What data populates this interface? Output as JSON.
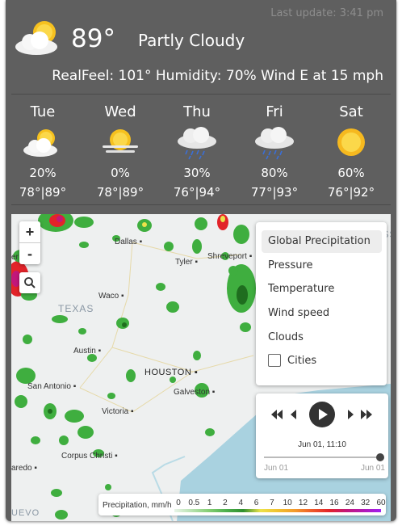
{
  "header": {
    "last_update": "Last update: 3:41 pm",
    "current_temp": "89°",
    "condition": "Partly Cloudy",
    "details": "RealFeel: 101° Humidity: 70% Wind E at 15 mph",
    "current_icon": "partly-cloudy-icon"
  },
  "forecast": [
    {
      "day": "Tue",
      "icon": "partly-cloudy-icon",
      "precip": "20%",
      "temps": "78°|89°"
    },
    {
      "day": "Wed",
      "icon": "hazy-sun-icon",
      "precip": "0%",
      "temps": "78°|89°"
    },
    {
      "day": "Thu",
      "icon": "rain-cloud-icon",
      "precip": "30%",
      "temps": "76°|94°"
    },
    {
      "day": "Fri",
      "icon": "rain-cloud-icon",
      "precip": "80%",
      "temps": "77°|93°"
    },
    {
      "day": "Sat",
      "icon": "sun-icon",
      "precip": "60%",
      "temps": "76°|92°"
    }
  ],
  "map": {
    "zoom_in": "+",
    "zoom_out": "-",
    "state_label": "TEXAS",
    "cities": {
      "dallas": "Dallas",
      "tyler": "Tyler",
      "shreveport": "Shreveport",
      "waco": "Waco",
      "austin": "Austin",
      "houston": "HOUSTON",
      "galveston": "Galveston",
      "san_antonio": "San Antonio",
      "victoria": "Victoria",
      "corpus_christi": "Corpus Christi",
      "laredo": "aredo",
      "nuevo": "UEVO",
      "left_edge": "er",
      "ms": "ISS"
    },
    "layers": {
      "global_precipitation": "Global Precipitation",
      "pressure": "Pressure",
      "temperature": "Temperature",
      "wind_speed": "Wind speed",
      "clouds": "Clouds",
      "cities": "Cities"
    },
    "player": {
      "time": "Jun 01, 11:10",
      "range_start": "Jun 01",
      "range_end": "Jun 01",
      "progress": 1.0
    },
    "legend": {
      "title": "Precipitation, mm/h",
      "ticks": [
        "0",
        "0.5",
        "1",
        "2",
        "4",
        "6",
        "7",
        "10",
        "12",
        "14",
        "16",
        "24",
        "32",
        "60"
      ]
    }
  },
  "colors": {
    "panel": "#5f5f5f",
    "text": "#ffffff",
    "muted": "#8d8d8d",
    "rain_green": "#3fae3f",
    "rain_red": "#e22329",
    "rain_magenta": "#c2177a"
  }
}
